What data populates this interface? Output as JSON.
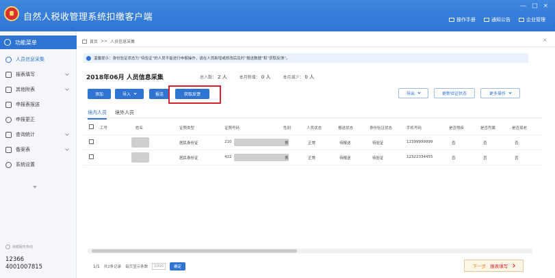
{
  "app": {
    "title": "自然人税收管理系统扣缴客户端",
    "top_actions": [
      "操作手册",
      "通知公告",
      "企业管理"
    ],
    "window_controls": [
      "—",
      "□",
      "×"
    ]
  },
  "sidebar": {
    "function_menu_label": "功能菜单",
    "items": [
      {
        "label": "人员信息采集",
        "icon": "person-icon",
        "active": true
      },
      {
        "label": "报表填写",
        "icon": "edit-icon",
        "active": false
      },
      {
        "label": "其他附表",
        "icon": "grid-icon",
        "active": false
      },
      {
        "label": "申报表报送",
        "icon": "send-icon",
        "active": false
      },
      {
        "label": "申报更正",
        "icon": "correct-icon",
        "active": false
      },
      {
        "label": "查询统计",
        "icon": "stats-icon",
        "active": false
      },
      {
        "label": "备案表",
        "icon": "folder-icon",
        "active": false
      },
      {
        "label": "系统设置",
        "icon": "gear-icon",
        "active": false
      }
    ],
    "hotline_label": "纳税服务热线",
    "hotline_numbers": [
      "12366",
      "4001007815"
    ]
  },
  "main": {
    "breadcrumb": [
      "首页",
      ">>",
      "人员信息采集"
    ],
    "notice": "温馨提示：身份验证状态为“待验证”的人员不能进行申报操作，请在人员新增或修改后及时“报送数据”和“获取反馈”。",
    "heading": "2018年06月 人员信息采集",
    "stats": [
      {
        "label": "总人数：",
        "value": "2 人"
      },
      {
        "label": "本月新增：",
        "value": "0 人"
      },
      {
        "label": "本月减少：",
        "value": "0 人"
      }
    ],
    "buttons": {
      "add": "添加",
      "import": "导入",
      "report": "报送",
      "get_feedback": "获取反馈",
      "export": "导出",
      "update_status": "更新验证状态",
      "more": "更多操作"
    },
    "subtabs": [
      "境内人员",
      "境外人员"
    ],
    "table": {
      "columns": [
        "工号",
        "姓名",
        "证照类型",
        "证照号码",
        "性别",
        "人员状态",
        "报送状态",
        "身份验证状态",
        "手机号码",
        "是否残疾",
        "是否烈属",
        "是否孤老"
      ],
      "rows": [
        {
          "id": "",
          "id_type": "居民身份证",
          "id_number": "210",
          "gender": "男",
          "status": "正常",
          "report_status": "待报送",
          "verify_status": "待验证",
          "phone": "12399999999",
          "disabled": "否",
          "martyr": "否",
          "elderly": "否"
        },
        {
          "id": "",
          "id_type": "居民身份证",
          "id_number": "422",
          "gender": "男",
          "status": "正常",
          "report_status": "待报送",
          "verify_status": "待验证",
          "phone": "12322334455",
          "disabled": "否",
          "martyr": "否",
          "elderly": "否"
        }
      ]
    },
    "pager": {
      "page_info": "1/1",
      "total_text": "共2条记录",
      "page_size_label": "每页显示条数",
      "page_size": "1000",
      "confirm": "确定"
    },
    "next_step": {
      "label": "下一步",
      "target": "报表填写"
    }
  },
  "colors": {
    "primary": "#2f74d2",
    "highlight": "#d6202a",
    "next_text": "#e08a1e"
  }
}
